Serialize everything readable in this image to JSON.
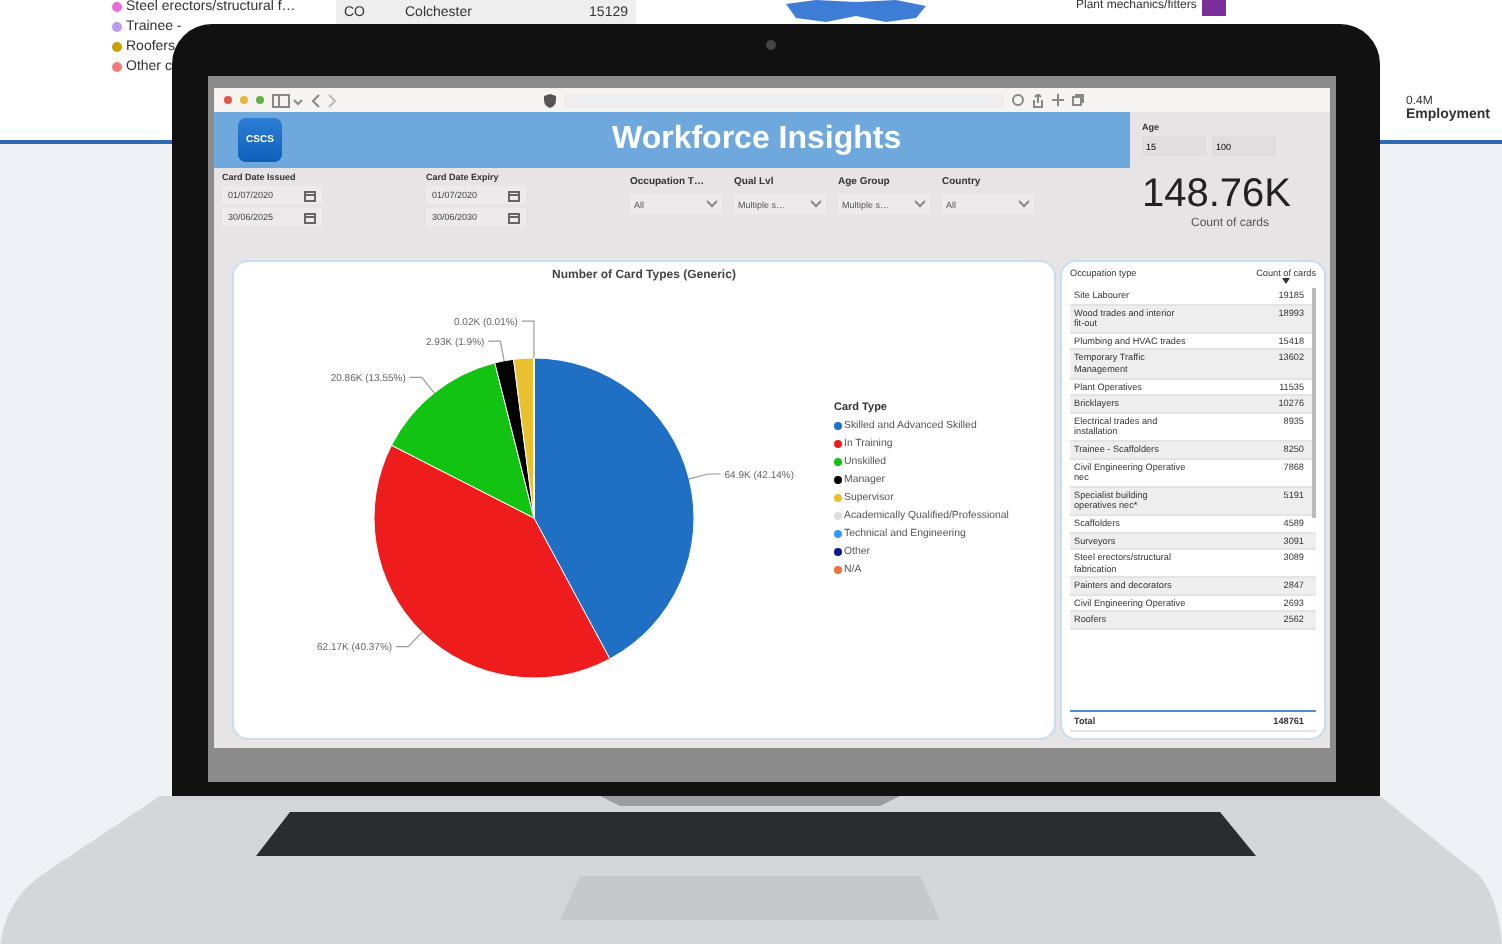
{
  "background_dashboard": {
    "legend": [
      {
        "label": "Steel erectors/structural f…",
        "color": "#e86ad8"
      },
      {
        "label": "Trainee -",
        "color": "#b89af0"
      },
      {
        "label": "Roofers",
        "color": "#c8a200"
      },
      {
        "label": "Other c",
        "color": "#f47b7b"
      }
    ],
    "table_row": [
      "CO",
      "Colchester",
      "15129"
    ],
    "bar_label": "Plant mechanics/fitters",
    "axis_tick": "0.4M",
    "axis_title": "Employment"
  },
  "header": {
    "logo": "CSCS",
    "title": "Workforce Insights"
  },
  "date_filters": [
    {
      "label": "Card Date Issued",
      "from": "01/07/2020",
      "to": "30/06/2025"
    },
    {
      "label": "Card Date Expiry",
      "from": "01/07/2020",
      "to": "30/06/2030"
    }
  ],
  "dropdowns": [
    {
      "label": "Occupation T…",
      "value": "All"
    },
    {
      "label": "Qual Lvl",
      "value": "Multiple s…"
    },
    {
      "label": "Age Group",
      "value": "Multiple s…"
    },
    {
      "label": "Country",
      "value": "All"
    }
  ],
  "age": {
    "label": "Age",
    "min": "15",
    "max": "100"
  },
  "kpi": {
    "value": "148.76K",
    "label": "Count of cards"
  },
  "chart": {
    "legend_title": "Card Type",
    "chart_data": {
      "type": "pie",
      "title": "Number of Card Types (Generic)",
      "categories": [
        "Skilled and Advanced Skilled",
        "In Training",
        "Unskilled",
        "Manager",
        "Supervisor",
        "Academically Qualified/Professional",
        "Technical and Engineering",
        "Other",
        "N/A"
      ],
      "values": [
        42.14,
        40.37,
        13.55,
        1.9,
        2.03,
        0.01,
        0,
        0,
        0
      ],
      "colors": [
        "#1f6fc5",
        "#ee1c1c",
        "#12c312",
        "#000000",
        "#e8c030",
        "#dddddd",
        "#3399ff",
        "#0a1a8a",
        "#f07040"
      ],
      "value_labels": [
        "64.9K (42.14%)",
        "62.17K (40.37%)",
        "20.86K (13.55%)",
        "2.93K (1.9%)",
        null,
        "0.02K (0.01%)",
        null,
        null,
        null
      ]
    }
  },
  "table": {
    "columns": [
      {
        "label": "Occupation type",
        "sorted": false
      },
      {
        "label": "Count of cards",
        "sorted": true
      }
    ],
    "rows": [
      [
        "Site Labourer",
        "19185"
      ],
      [
        "Wood trades and interior fit-out",
        "18993"
      ],
      [
        "Plumbing and HVAC trades",
        "15418"
      ],
      [
        "Temporary Traffic Management",
        "13602"
      ],
      [
        "Plant Operatives",
        "11535"
      ],
      [
        "Bricklayers",
        "10276"
      ],
      [
        "Electrical trades and installation",
        "8935"
      ],
      [
        "Trainee - Scaffolders",
        "8250"
      ],
      [
        "Civil Engineering Operative nec",
        "7868"
      ],
      [
        "Specialist building operatives nec*",
        "5191"
      ],
      [
        "Scaffolders",
        "4589"
      ],
      [
        "Surveyors",
        "3091"
      ],
      [
        "Steel erectors/structural fabrication",
        "3089"
      ],
      [
        "Painters and decorators",
        "2847"
      ],
      [
        "Civil Engineering Operative",
        "2693"
      ],
      [
        "Roofers",
        "2562"
      ]
    ],
    "total": [
      "Total",
      "148761"
    ]
  }
}
